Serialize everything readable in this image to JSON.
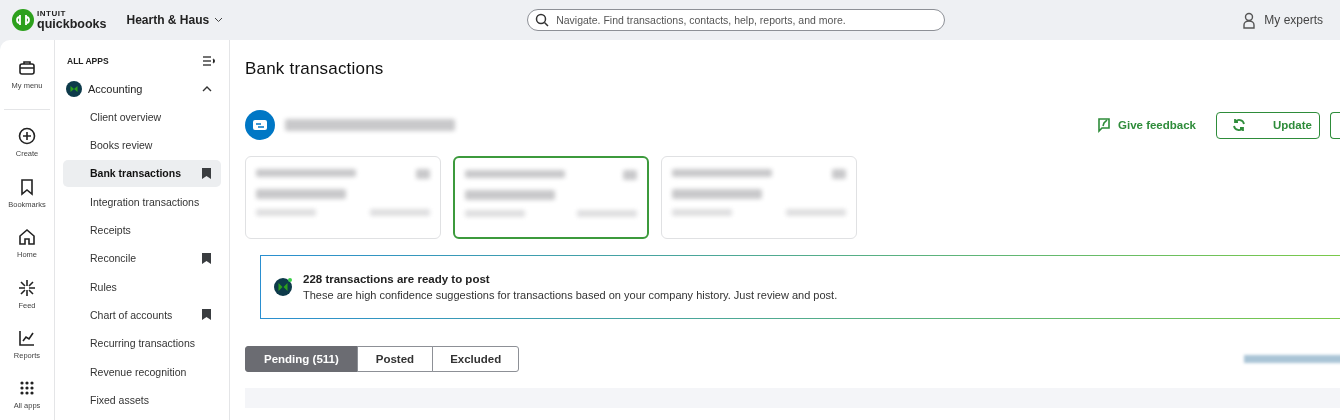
{
  "header": {
    "logo_top": "INTUIT",
    "logo_bottom": "quickbooks",
    "company": "Hearth & Haus",
    "search": {
      "placeholder": "Navigate. Find transactions, contacts, help, reports, and more."
    },
    "experts": "My experts"
  },
  "rail": [
    {
      "kind": "menu",
      "label": "My menu"
    },
    {
      "kind": "create",
      "label": "Create"
    },
    {
      "kind": "bookmarks",
      "label": "Bookmarks"
    },
    {
      "kind": "home",
      "label": "Home"
    },
    {
      "kind": "feed",
      "label": "Feed"
    },
    {
      "kind": "reports",
      "label": "Reports"
    },
    {
      "kind": "apps",
      "label": "All apps"
    }
  ],
  "nav": {
    "heading": "ALL APPS",
    "section": "Accounting",
    "expanded": true,
    "items": [
      {
        "label": "Client overview",
        "selected": false,
        "bookmarked": false
      },
      {
        "label": "Books review",
        "selected": false,
        "bookmarked": false
      },
      {
        "label": "Bank transactions",
        "selected": true,
        "bookmarked": true
      },
      {
        "label": "Integration transactions",
        "selected": false,
        "bookmarked": false
      },
      {
        "label": "Receipts",
        "selected": false,
        "bookmarked": false
      },
      {
        "label": "Reconcile",
        "selected": false,
        "bookmarked": true
      },
      {
        "label": "Rules",
        "selected": false,
        "bookmarked": false
      },
      {
        "label": "Chart of accounts",
        "selected": false,
        "bookmarked": true
      },
      {
        "label": "Recurring transactions",
        "selected": false,
        "bookmarked": false
      },
      {
        "label": "Revenue recognition",
        "selected": false,
        "bookmarked": false
      },
      {
        "label": "Fixed assets",
        "selected": false,
        "bookmarked": false
      }
    ]
  },
  "main": {
    "title": "Bank transactions",
    "feedback": "Give feedback",
    "update": "Update",
    "accounts": [
      {
        "selected": false
      },
      {
        "selected": true
      },
      {
        "selected": false
      }
    ],
    "banner": {
      "title": "228 transactions are ready to post",
      "body": "These are high confidence suggestions for transactions based on your company history. Just review and post."
    },
    "tabs": [
      {
        "label": "Pending (511)",
        "selected": true
      },
      {
        "label": "Posted",
        "selected": false
      },
      {
        "label": "Excluded",
        "selected": false
      }
    ]
  }
}
